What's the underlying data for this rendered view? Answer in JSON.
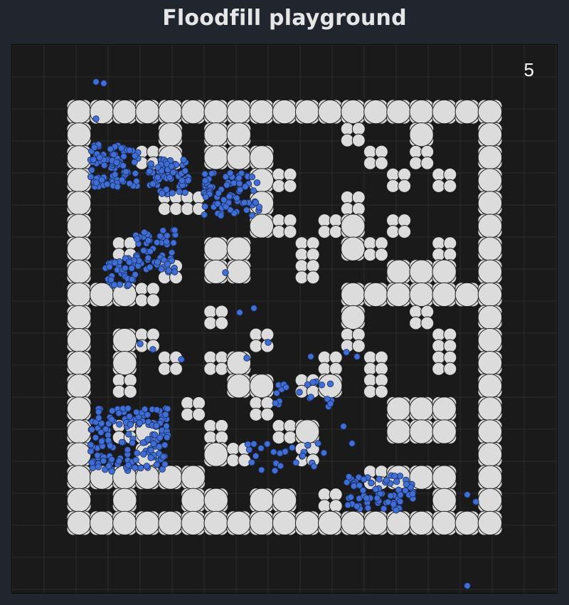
{
  "app": {
    "title": "Floodfill playground"
  },
  "hud": {
    "counter_value": "5"
  },
  "colors": {
    "page_background": "#21262e",
    "board_background": "#1a1a1a",
    "grid_line": "#2c2c2c",
    "wall_fill": "#dcdcdc",
    "wall_stroke": "#1e1e1e",
    "particle_fill": "#3f6fd6",
    "particle_stroke": "#1b2a5a"
  },
  "maze": {
    "rows": [
      "1111111111111111111",
      "1000101100001001001",
      "1001101110000101001",
      "1000000011000010101",
      "1000110010001000001",
      "1000000011011010001",
      "1010001100101100101",
      "1000101100100011101",
      "1111000000001111111",
      "1000001000001001001",
      "1011000010001000101",
      "1010101100010100101",
      "1010000110110100001",
      "1000010010000011101",
      "1011001001100011101",
      "1001001100100000001",
      "1111110000000111101",
      "1010011011010000101",
      "1111111111111111111"
    ]
  }
}
